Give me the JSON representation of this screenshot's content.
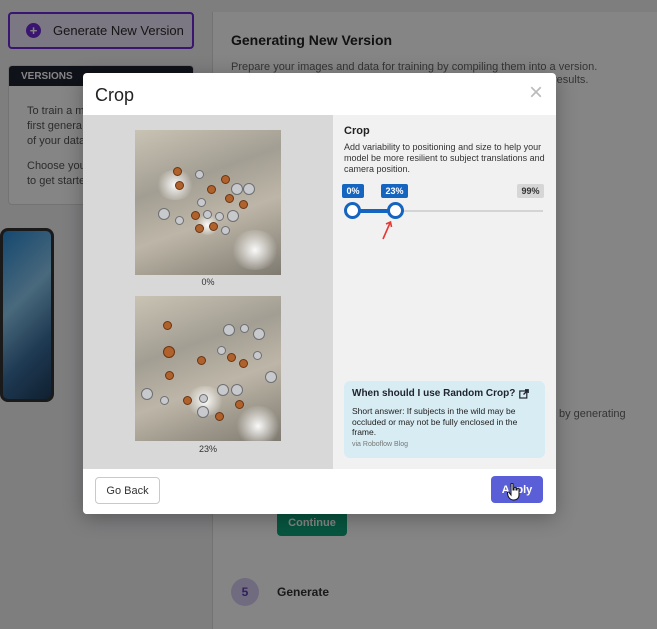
{
  "background": {
    "generate_button": "Generate New Version",
    "versions": {
      "header": "VERSIONS",
      "line1": "To train a m",
      "line2": "first genera",
      "line3": "of your data",
      "line4": "Choose you",
      "line5": "to get starte"
    },
    "main": {
      "title": "Generating New Version",
      "description": "Prepare your images and data for training by compiling them into a version.",
      "desc_fragment": "results.",
      "by_generating": "by generating",
      "continue_label": "Continue",
      "step_number": "5",
      "step_label": "Generate"
    }
  },
  "modal": {
    "title": "Crop",
    "close_glyph": "×",
    "preview_labels": [
      "0%",
      "23%"
    ],
    "settings": {
      "title": "Crop",
      "description": "Add variability to positioning and size to help your model be more resilient to subject translations and camera position.",
      "slider": {
        "min_label": "0%",
        "current_label": "23%",
        "max_label": "99%",
        "min": 0,
        "max": 99,
        "value": 23
      }
    },
    "info": {
      "title": "When should I use Random Crop?",
      "text": "Short answer: If subjects in the wild may be occluded or may not be fully enclosed in the frame.",
      "source": "via Roboflow Blog"
    },
    "footer": {
      "back_label": "Go Back",
      "apply_label": "Apply"
    }
  },
  "colors": {
    "primary_purple": "#6d28d9",
    "slider_blue": "#1565c0",
    "apply_button": "#5a5fd8",
    "continue_green": "#0ea57a",
    "info_box": "#d8ecf3"
  }
}
